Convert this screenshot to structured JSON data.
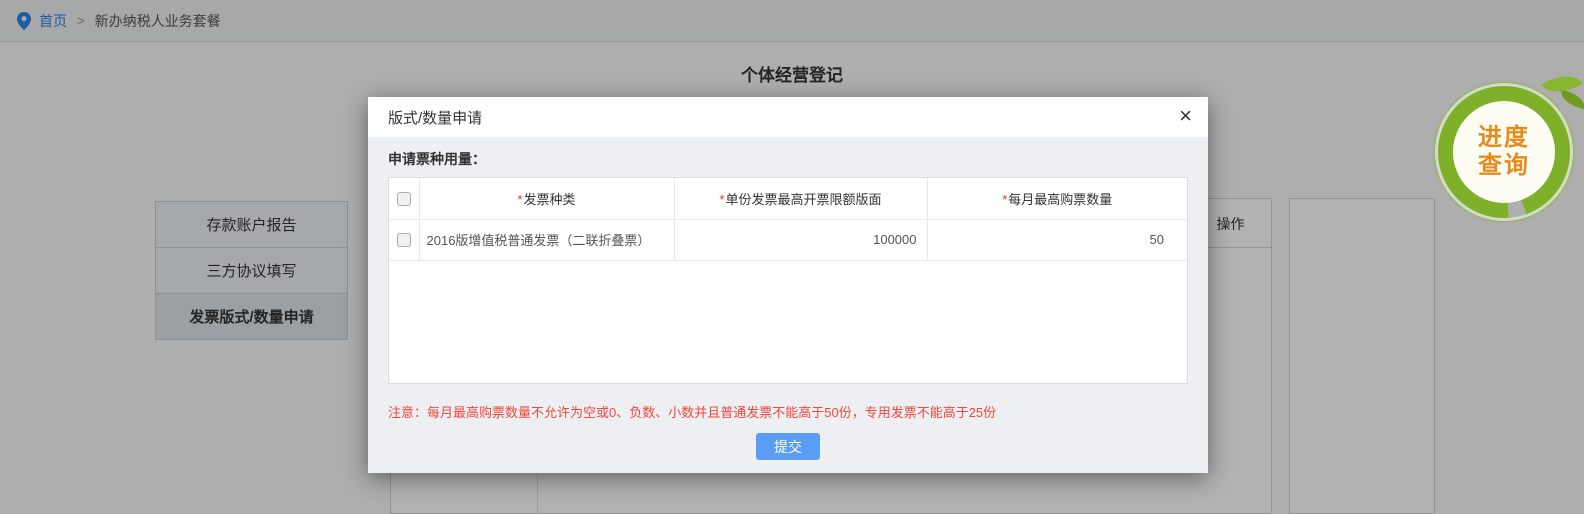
{
  "breadcrumb": {
    "home": "首页",
    "separator": ">",
    "current": "新办纳税人业务套餐"
  },
  "page": {
    "title": "个体经营登记"
  },
  "sidebar": {
    "items": [
      {
        "label": "存款账户报告",
        "selected": false
      },
      {
        "label": "三方协议填写",
        "selected": false
      },
      {
        "label": "发票版式/数量申请",
        "selected": true
      }
    ]
  },
  "background_table": {
    "action_header": "操作"
  },
  "progress_badge": {
    "line1": "进度",
    "line2": "查询"
  },
  "modal": {
    "title": "版式/数量申请",
    "close_glyph": "×",
    "section_label": "申请票种用量：",
    "table": {
      "required_mark": "*",
      "headers": [
        {
          "label": "发票种类"
        },
        {
          "label": "单份发票最高开票限额版面"
        },
        {
          "label": "每月最高购票数量"
        }
      ],
      "rows": [
        {
          "invoice_type": "2016版增值税普通发票（二联折叠票）",
          "max_invoice_limit": "100000",
          "max_monthly_count": "50"
        }
      ]
    },
    "note": "注意：每月最高购票数量不允许为空或0、负数、小数并且普通发票不能高于50份，专用发票不能高于25份",
    "submit_label": "提交"
  },
  "colors": {
    "accent_blue": "#5a9df5",
    "breadcrumb_link": "#2b83e8",
    "note_red": "#f4473d",
    "required_red": "#e8342a",
    "badge_ring_green": "#7fb02a",
    "badge_text_orange": "#e78a1c"
  }
}
